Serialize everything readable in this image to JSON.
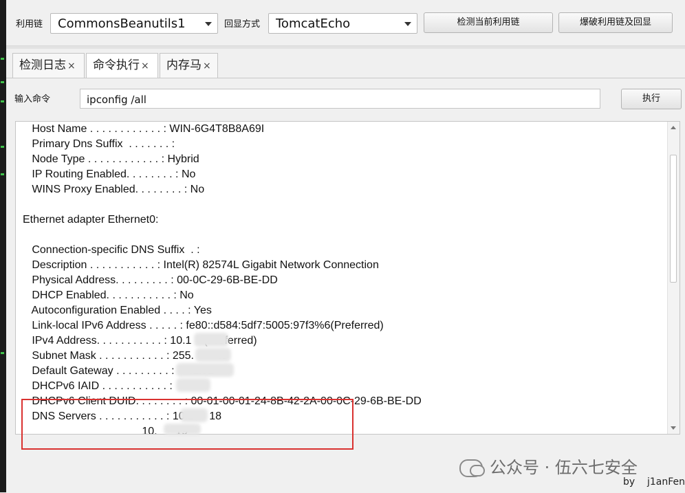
{
  "toolbar": {
    "chain_label": "利用链",
    "chain_value": "CommonsBeanutils1",
    "echo_label": "回显方式",
    "echo_value": "TomcatEcho",
    "detect_button": "检测当前利用链",
    "bruteforce_button": "爆破利用链及回显"
  },
  "tabs": [
    {
      "label": "检测日志",
      "close": "×"
    },
    {
      "label": "命令执行",
      "close": "×"
    },
    {
      "label": "内存马",
      "close": "×"
    }
  ],
  "command": {
    "label": "输入命令",
    "value": "ipconfig /all",
    "execute_button": "执行"
  },
  "output_lines": [
    "   Host Name . . . . . . . . . . . . : WIN-6G4T8B8A69I",
    "   Primary Dns Suffix  . . . . . . . :",
    "   Node Type . . . . . . . . . . . . : Hybrid",
    "   IP Routing Enabled. . . . . . . . : No",
    "   WINS Proxy Enabled. . . . . . . . : No",
    "",
    "Ethernet adapter Ethernet0:",
    "",
    "   Connection-specific DNS Suffix  . :",
    "   Description . . . . . . . . . . . : Intel(R) 82574L Gigabit Network Connection",
    "   Physical Address. . . . . . . . . : 00-0C-29-6B-BE-DD",
    "   DHCP Enabled. . . . . . . . . . . : No",
    "   Autoconfiguration Enabled . . . . : Yes",
    "   Link-local IPv6 Address . . . . . : fe80::d584:5df7:5005:97f3%6(Preferred)",
    "   IPv4 Address. . . . . . . . . . . : 10.1    (Preferred)",
    "   Subnet Mask . . . . . . . . . . . : 255.        .0",
    "   Default Gateway . . . . . . . . . :     .1.51",
    "   DHCPv6 IAID . . . . . . . . . . . :",
    "   DHCPv6 Client DUID. . . . . . . . : 00-01-00-01-24-8B-42-2A-00-0C-29-6B-BE-DD",
    "   DNS Servers . . . . . . . . . . . : 10.1     18",
    "                                       10.      19"
  ],
  "watermark": "公众号 · 伍六七安全",
  "byline": "by    j1anFen"
}
